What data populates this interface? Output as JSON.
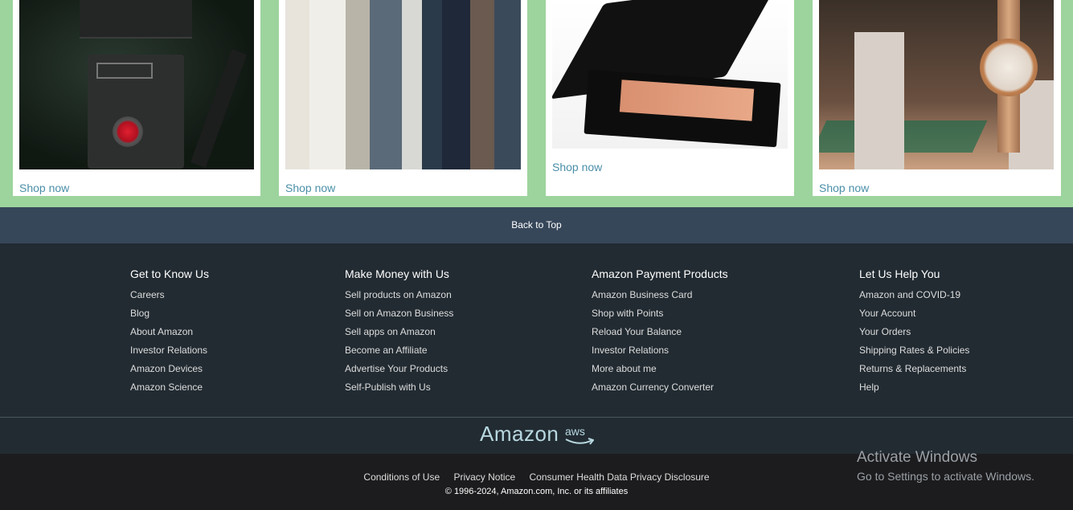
{
  "cards": [
    {
      "image_alt": "camera",
      "link": "Shop now"
    },
    {
      "image_alt": "clothes",
      "link": "Shop now"
    },
    {
      "image_alt": "compact",
      "link": "Shop now"
    },
    {
      "image_alt": "watch",
      "link": "Shop now"
    }
  ],
  "back_to_top": "Back to Top",
  "footer": {
    "columns": [
      {
        "title": "Get to Know Us",
        "links": [
          "Careers",
          "Blog",
          "About Amazon",
          "Investor Relations",
          "Amazon Devices",
          "Amazon Science"
        ]
      },
      {
        "title": "Make Money with Us",
        "links": [
          "Sell products on Amazon",
          "Sell on Amazon Business",
          "Sell apps on Amazon",
          "Become an Affiliate",
          "Advertise Your Products",
          "Self-Publish with Us"
        ]
      },
      {
        "title": "Amazon Payment Products",
        "links": [
          "Amazon Business Card",
          "Shop with Points",
          "Reload Your Balance",
          "Investor Relations",
          "More about me",
          "Amazon Currency Converter"
        ]
      },
      {
        "title": "Let Us Help You",
        "links": [
          "Amazon and COVID-19",
          "Your Account",
          "Your Orders",
          "Shipping Rates & Policies",
          "Returns & Replacements",
          "Help"
        ]
      }
    ],
    "logo_text": "Amazon",
    "logo_sub": "aws"
  },
  "legal": {
    "links": [
      "Conditions of Use",
      "Privacy Notice",
      "Consumer Health Data Privacy Disclosure"
    ],
    "copyright": "© 1996-2024, Amazon.com, Inc. or its affiliates"
  },
  "windows_watermark": {
    "title": "Activate Windows",
    "subtitle": "Go to Settings to activate Windows."
  },
  "colors": {
    "page_bg": "#9dd49d",
    "back_to_top_bg": "#37475a",
    "footer_bg": "#222b32",
    "bottom_bg": "#1c1c1e",
    "link_color": "#4a8fa8"
  }
}
